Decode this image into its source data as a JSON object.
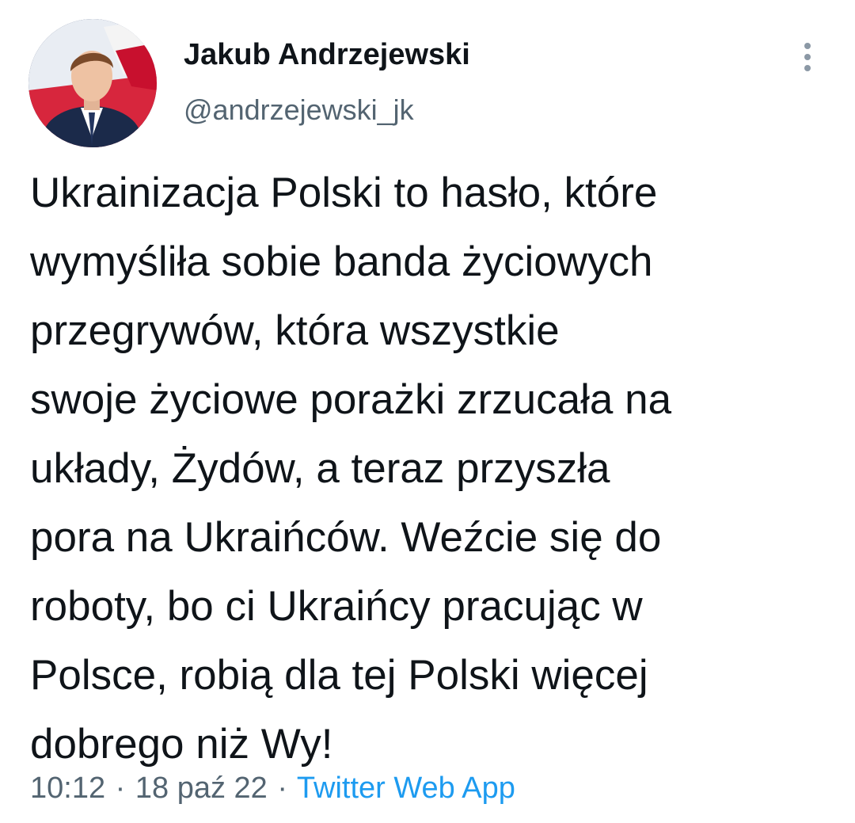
{
  "author": {
    "name": "Jakub Andrzejewski",
    "handle": "@andrzejewski_jk"
  },
  "tweet": {
    "lines": [
      "Ukrainizacja Polski to hasło, które",
      "wymyśliła sobie banda życiowych",
      "przegrywów, która wszystkie",
      "swoje życiowe porażki zrzucała na",
      "układy, Żydów, a teraz przyszła",
      "pora na Ukraińców. Weźcie się do",
      "roboty, bo ci Ukraińcy pracując w",
      "Polsce, robią dla tej Polski więcej",
      "dobrego niż Wy!"
    ]
  },
  "meta": {
    "time": "10:12",
    "separator": "·",
    "date": "18 paź 22",
    "source": "Twitter Web App"
  },
  "colors": {
    "text": "#0f1419",
    "secondary": "#536471",
    "link": "#1d9bf0"
  },
  "icons": {
    "more": "more-vertical-icon"
  }
}
